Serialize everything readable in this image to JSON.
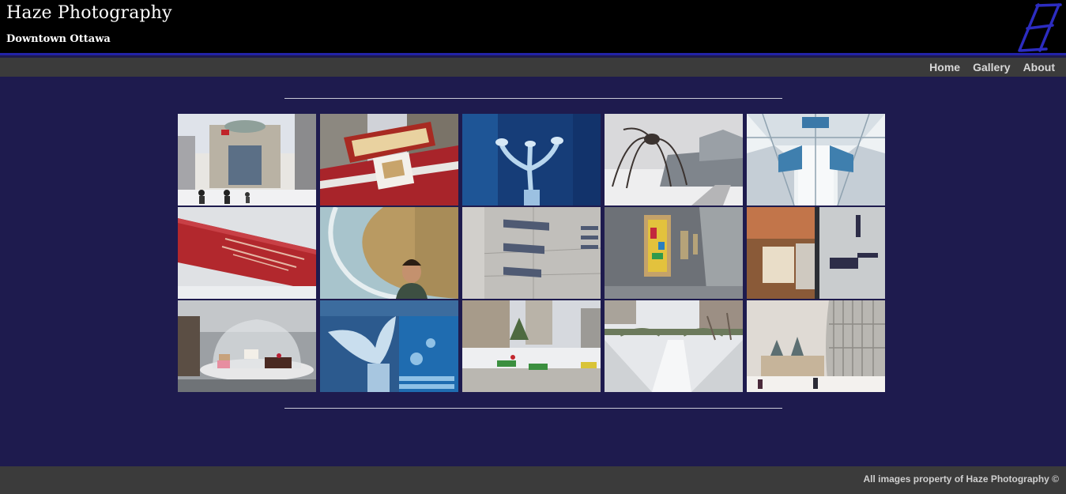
{
  "header": {
    "title": "Haze Photography",
    "subtitle": "Downtown Ottawa",
    "logo_icon": "italic-h-logo",
    "accent_color": "#2323a8"
  },
  "nav": {
    "items": [
      {
        "label": "Home"
      },
      {
        "label": "Gallery"
      },
      {
        "label": "About"
      }
    ]
  },
  "gallery": {
    "photos": [
      {
        "subject": "city-hall-plaza-photo"
      },
      {
        "subject": "beavertails-sign-photo"
      },
      {
        "subject": "ice-sculpture-blue-photo"
      },
      {
        "subject": "maman-spider-national-gallery-photo"
      },
      {
        "subject": "glass-atrium-ceiling-photo"
      },
      {
        "subject": "national-gallery-ticket-photo"
      },
      {
        "subject": "man-in-curved-wall-photo"
      },
      {
        "subject": "european-american-galleries-sign-photo"
      },
      {
        "subject": "gallery-paintings-wall-photo"
      },
      {
        "subject": "cafe-des-beaux-arts-photo"
      },
      {
        "subject": "macarons-cake-dome-photo"
      },
      {
        "subject": "winterlude-ice-sculpture-photo"
      },
      {
        "subject": "skating-rink-city-photo"
      },
      {
        "subject": "rideau-canal-bridge-photo"
      },
      {
        "subject": "chateau-laurier-winter-photo"
      }
    ]
  },
  "footer": {
    "text": "All images property of Haze Photography ©"
  },
  "colors": {
    "background": "#1e1b4e",
    "header": "#000000",
    "bar": "#3b3b3b"
  }
}
